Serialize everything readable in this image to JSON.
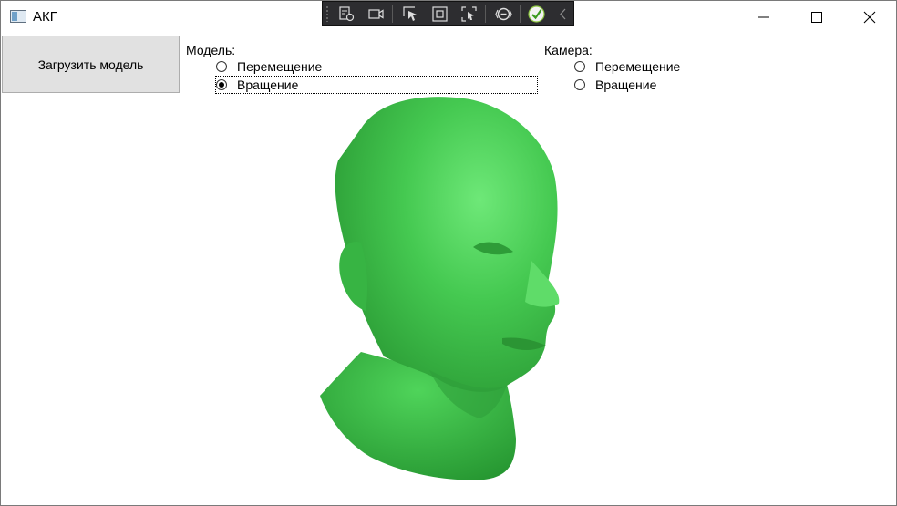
{
  "window": {
    "title": "АКГ"
  },
  "window_controls": {
    "minimize": "minimize-icon",
    "maximize": "maximize-icon",
    "close": "close-icon"
  },
  "debug_toolbar": {
    "icons": [
      "live-visual-tree-icon",
      "record-icon",
      "select-element-icon",
      "display-layout-adorners-icon",
      "track-focus-icon",
      "binding-failures-icon",
      "check-icon",
      "collapse-chevron-icon"
    ]
  },
  "toolbar": {
    "load_model_label": "Загрузить модель"
  },
  "model_group": {
    "label": "Модель:",
    "options": [
      {
        "label": "Перемещение",
        "checked": false
      },
      {
        "label": "Вращение",
        "checked": true
      }
    ]
  },
  "camera_group": {
    "label": "Камера:",
    "options": [
      {
        "label": "Перемещение",
        "checked": false
      },
      {
        "label": "Вращение",
        "checked": false
      }
    ]
  },
  "viewport": {
    "model_color": "#3fc04d"
  }
}
